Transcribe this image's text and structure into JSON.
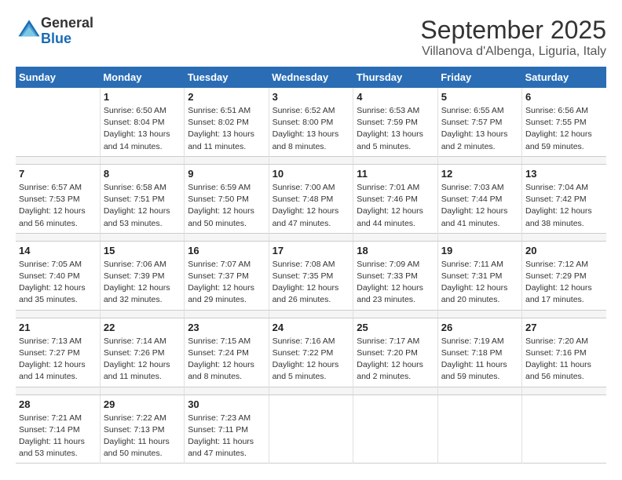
{
  "logo": {
    "line1": "General",
    "line2": "Blue"
  },
  "title": "September 2025",
  "subtitle": "Villanova d'Albenga, Liguria, Italy",
  "days_of_week": [
    "Sunday",
    "Monday",
    "Tuesday",
    "Wednesday",
    "Thursday",
    "Friday",
    "Saturday"
  ],
  "weeks": [
    [
      {
        "day": "",
        "info": ""
      },
      {
        "day": "1",
        "info": "Sunrise: 6:50 AM\nSunset: 8:04 PM\nDaylight: 13 hours\nand 14 minutes."
      },
      {
        "day": "2",
        "info": "Sunrise: 6:51 AM\nSunset: 8:02 PM\nDaylight: 13 hours\nand 11 minutes."
      },
      {
        "day": "3",
        "info": "Sunrise: 6:52 AM\nSunset: 8:00 PM\nDaylight: 13 hours\nand 8 minutes."
      },
      {
        "day": "4",
        "info": "Sunrise: 6:53 AM\nSunset: 7:59 PM\nDaylight: 13 hours\nand 5 minutes."
      },
      {
        "day": "5",
        "info": "Sunrise: 6:55 AM\nSunset: 7:57 PM\nDaylight: 13 hours\nand 2 minutes."
      },
      {
        "day": "6",
        "info": "Sunrise: 6:56 AM\nSunset: 7:55 PM\nDaylight: 12 hours\nand 59 minutes."
      }
    ],
    [
      {
        "day": "7",
        "info": "Sunrise: 6:57 AM\nSunset: 7:53 PM\nDaylight: 12 hours\nand 56 minutes."
      },
      {
        "day": "8",
        "info": "Sunrise: 6:58 AM\nSunset: 7:51 PM\nDaylight: 12 hours\nand 53 minutes."
      },
      {
        "day": "9",
        "info": "Sunrise: 6:59 AM\nSunset: 7:50 PM\nDaylight: 12 hours\nand 50 minutes."
      },
      {
        "day": "10",
        "info": "Sunrise: 7:00 AM\nSunset: 7:48 PM\nDaylight: 12 hours\nand 47 minutes."
      },
      {
        "day": "11",
        "info": "Sunrise: 7:01 AM\nSunset: 7:46 PM\nDaylight: 12 hours\nand 44 minutes."
      },
      {
        "day": "12",
        "info": "Sunrise: 7:03 AM\nSunset: 7:44 PM\nDaylight: 12 hours\nand 41 minutes."
      },
      {
        "day": "13",
        "info": "Sunrise: 7:04 AM\nSunset: 7:42 PM\nDaylight: 12 hours\nand 38 minutes."
      }
    ],
    [
      {
        "day": "14",
        "info": "Sunrise: 7:05 AM\nSunset: 7:40 PM\nDaylight: 12 hours\nand 35 minutes."
      },
      {
        "day": "15",
        "info": "Sunrise: 7:06 AM\nSunset: 7:39 PM\nDaylight: 12 hours\nand 32 minutes."
      },
      {
        "day": "16",
        "info": "Sunrise: 7:07 AM\nSunset: 7:37 PM\nDaylight: 12 hours\nand 29 minutes."
      },
      {
        "day": "17",
        "info": "Sunrise: 7:08 AM\nSunset: 7:35 PM\nDaylight: 12 hours\nand 26 minutes."
      },
      {
        "day": "18",
        "info": "Sunrise: 7:09 AM\nSunset: 7:33 PM\nDaylight: 12 hours\nand 23 minutes."
      },
      {
        "day": "19",
        "info": "Sunrise: 7:11 AM\nSunset: 7:31 PM\nDaylight: 12 hours\nand 20 minutes."
      },
      {
        "day": "20",
        "info": "Sunrise: 7:12 AM\nSunset: 7:29 PM\nDaylight: 12 hours\nand 17 minutes."
      }
    ],
    [
      {
        "day": "21",
        "info": "Sunrise: 7:13 AM\nSunset: 7:27 PM\nDaylight: 12 hours\nand 14 minutes."
      },
      {
        "day": "22",
        "info": "Sunrise: 7:14 AM\nSunset: 7:26 PM\nDaylight: 12 hours\nand 11 minutes."
      },
      {
        "day": "23",
        "info": "Sunrise: 7:15 AM\nSunset: 7:24 PM\nDaylight: 12 hours\nand 8 minutes."
      },
      {
        "day": "24",
        "info": "Sunrise: 7:16 AM\nSunset: 7:22 PM\nDaylight: 12 hours\nand 5 minutes."
      },
      {
        "day": "25",
        "info": "Sunrise: 7:17 AM\nSunset: 7:20 PM\nDaylight: 12 hours\nand 2 minutes."
      },
      {
        "day": "26",
        "info": "Sunrise: 7:19 AM\nSunset: 7:18 PM\nDaylight: 11 hours\nand 59 minutes."
      },
      {
        "day": "27",
        "info": "Sunrise: 7:20 AM\nSunset: 7:16 PM\nDaylight: 11 hours\nand 56 minutes."
      }
    ],
    [
      {
        "day": "28",
        "info": "Sunrise: 7:21 AM\nSunset: 7:14 PM\nDaylight: 11 hours\nand 53 minutes."
      },
      {
        "day": "29",
        "info": "Sunrise: 7:22 AM\nSunset: 7:13 PM\nDaylight: 11 hours\nand 50 minutes."
      },
      {
        "day": "30",
        "info": "Sunrise: 7:23 AM\nSunset: 7:11 PM\nDaylight: 11 hours\nand 47 minutes."
      },
      {
        "day": "",
        "info": ""
      },
      {
        "day": "",
        "info": ""
      },
      {
        "day": "",
        "info": ""
      },
      {
        "day": "",
        "info": ""
      }
    ]
  ]
}
